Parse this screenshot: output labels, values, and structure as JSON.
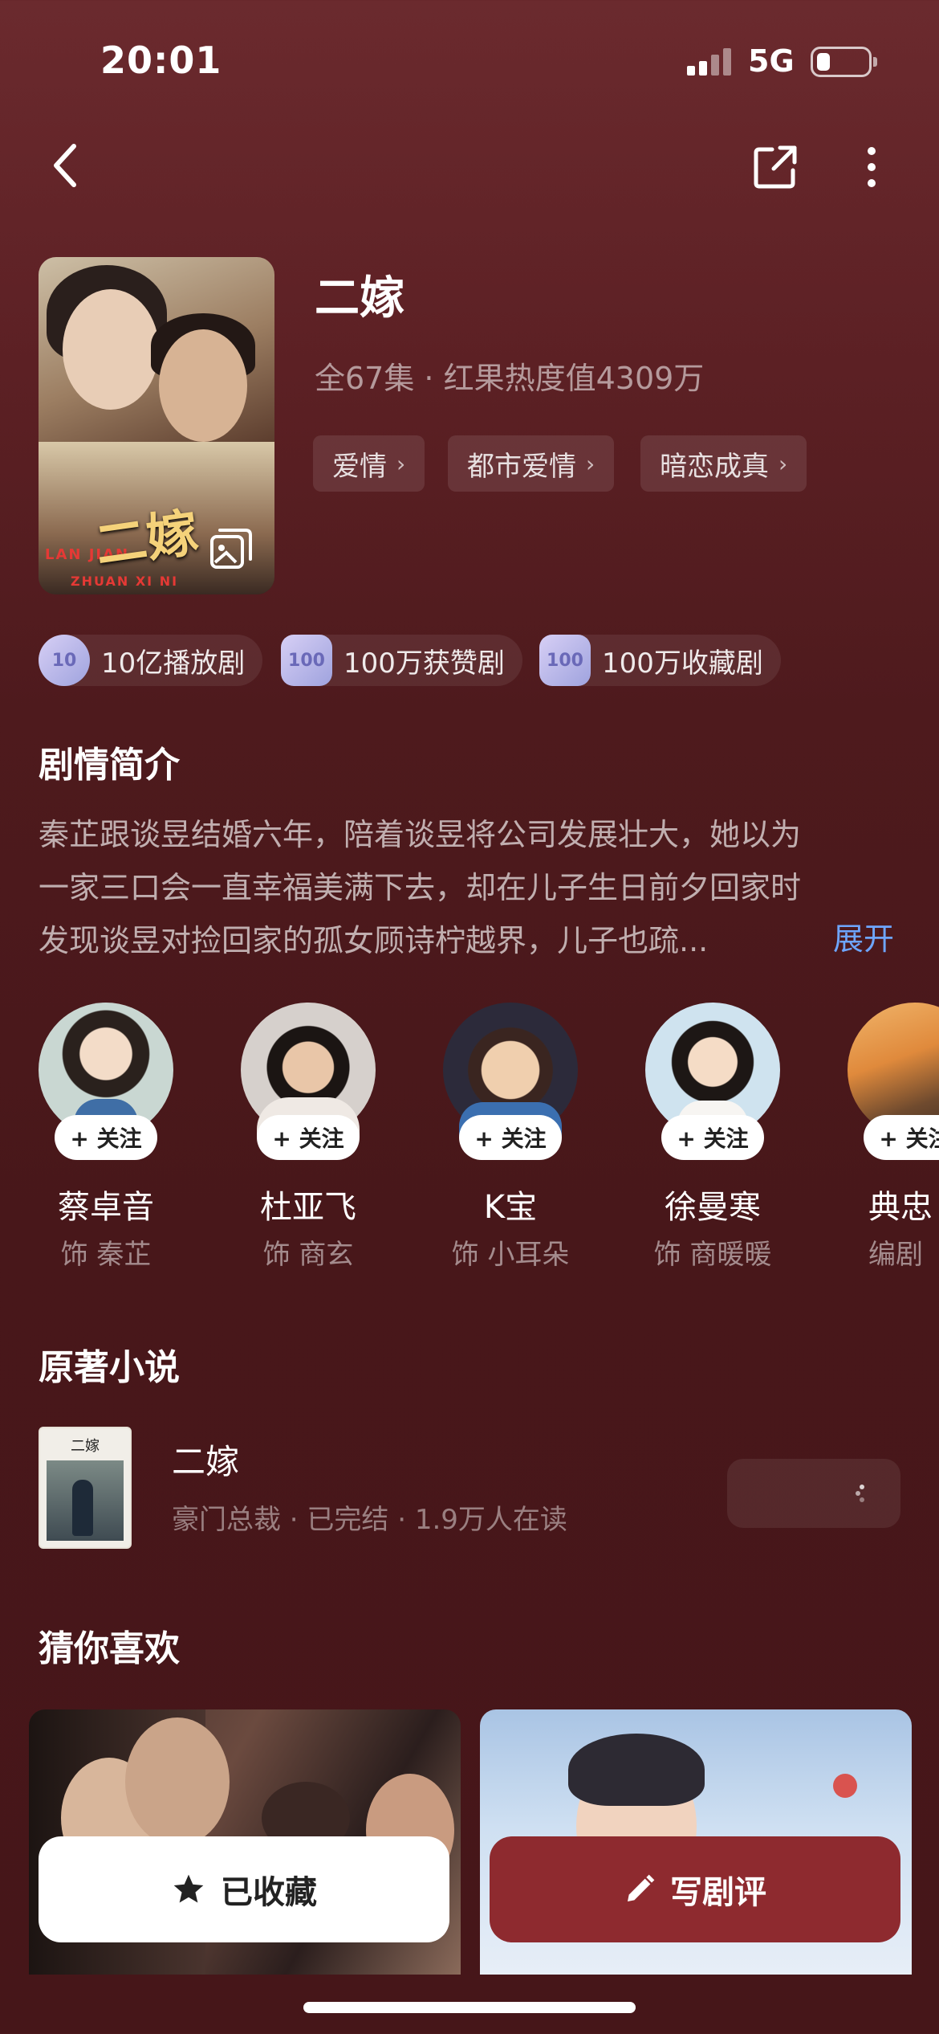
{
  "status_bar": {
    "time": "20:01",
    "network": "5G"
  },
  "show": {
    "title": "二嫁",
    "meta": "全67集 · 红果热度值4309万",
    "tags": [
      "爱情",
      "都市爱情",
      "暗恋成真"
    ],
    "poster_title": "二嫁"
  },
  "badges": [
    {
      "icon": "10",
      "label": "10亿播放剧"
    },
    {
      "icon": "100",
      "label": "100万获赞剧"
    },
    {
      "icon": "100",
      "label": "100万收藏剧"
    }
  ],
  "synopsis": {
    "heading": "剧情简介",
    "lines": [
      "秦芷跟谈昱结婚六年，陪着谈昱将公司发展壮大，她以为",
      "一家三口会一直幸福美满下去，却在儿子生日前夕回家时",
      "发现谈昱对捡回家的孤女顾诗柠越界，儿子也疏..."
    ],
    "expand_label": "展开"
  },
  "cast": {
    "follow_label": "+ 关注",
    "members": [
      {
        "name": "蔡卓音",
        "role": "饰 秦芷"
      },
      {
        "name": "杜亚飞",
        "role": "饰 商玄"
      },
      {
        "name": "K宝",
        "role": "饰 小耳朵"
      },
      {
        "name": "徐曼寒",
        "role": "饰 商暖暖"
      },
      {
        "name": "典忠",
        "role": "编剧"
      }
    ]
  },
  "novel": {
    "heading": "原著小说",
    "title": "二嫁",
    "meta": "豪门总裁 · 已完结 · 1.9万人在读",
    "cover_title": "二嫁"
  },
  "recommend": {
    "heading": "猜你喜欢"
  },
  "actions": {
    "favorite_label": "已收藏",
    "review_label": "写剧评"
  },
  "colors": {
    "background": "#4e1a1d",
    "accent": "#8e2a2f",
    "link": "#6ea6ff"
  }
}
